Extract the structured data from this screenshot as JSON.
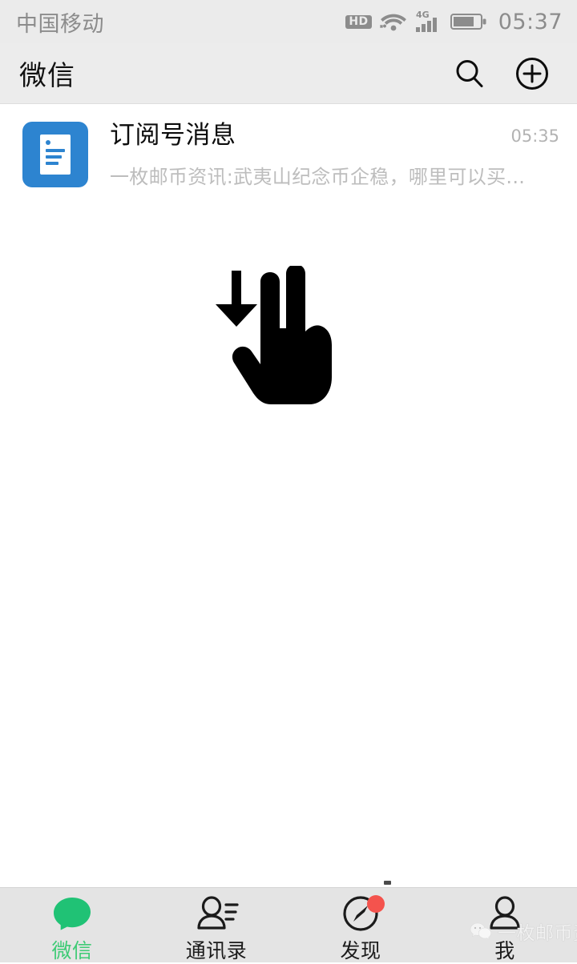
{
  "status_bar": {
    "carrier": "中国移动",
    "hd_label": "HD",
    "network_label": "4G",
    "icons": [
      "hd-badge-icon",
      "wifi-icon",
      "cellular-signal-icon",
      "battery-icon"
    ],
    "time": "05:37",
    "text_color": "#8c8c8c",
    "background": "#ebebeb"
  },
  "header": {
    "title": "微信",
    "search_icon": "search-icon",
    "add_icon": "plus-circle-icon",
    "background": "#ececec"
  },
  "chat_list": {
    "items": [
      {
        "avatar_icon": "subscription-document-icon",
        "avatar_color": "#2d84d0",
        "title": "订阅号消息",
        "snippet": "一枚邮币资讯:武夷山纪念币企稳，哪里可以买...",
        "time": "05:35"
      }
    ]
  },
  "gesture_overlay": {
    "icon": "two-finger-swipe-down-icon",
    "color": "#000000"
  },
  "tab_bar": {
    "background": "#e4e4e4",
    "active_color": "#3ecb75",
    "inactive_color": "#1b1b1b",
    "tabs": [
      {
        "label": "微信",
        "icon": "chat-bubble-icon",
        "active": true,
        "badge": false
      },
      {
        "label": "通讯录",
        "icon": "contacts-person-icon",
        "active": false,
        "badge": false
      },
      {
        "label": "发现",
        "icon": "compass-discover-icon",
        "active": false,
        "badge": true
      },
      {
        "label": "我",
        "icon": "profile-person-icon",
        "active": false,
        "badge": false
      }
    ]
  },
  "watermark": {
    "text": "一枚邮币资讯",
    "logo_icon": "wechat-logo-icon",
    "color": "#f2f2f2"
  }
}
